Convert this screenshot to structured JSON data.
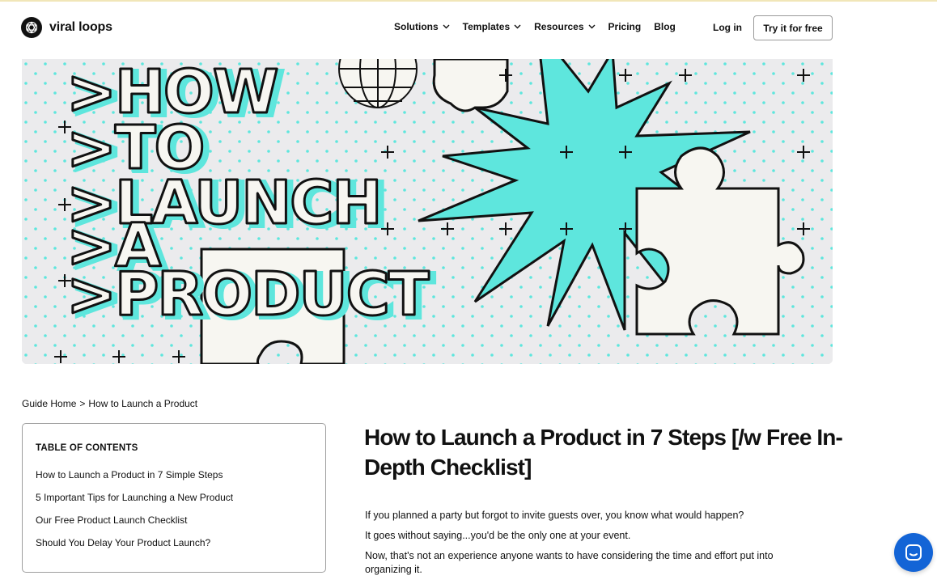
{
  "header": {
    "logo_text": "viral loops",
    "logo_icon": "viral-loops-logo-icon",
    "nav": [
      {
        "label": "Solutions",
        "has_dropdown": true
      },
      {
        "label": "Templates",
        "has_dropdown": true
      },
      {
        "label": "Resources",
        "has_dropdown": true
      },
      {
        "label": "Pricing",
        "has_dropdown": false
      },
      {
        "label": "Blog",
        "has_dropdown": false
      }
    ],
    "login_label": "Log in",
    "cta_label": "Try it for free"
  },
  "hero": {
    "lines": [
      ">HOW",
      ">TO",
      ">LAUNCH",
      ">A",
      ">PRODUCT"
    ],
    "colors": {
      "background": "#ebebed",
      "accent": "#5ee6dd",
      "ink": "#111111",
      "paper": "#f7f6f1"
    }
  },
  "breadcrumb": {
    "home": "Guide Home",
    "separator": ">",
    "current": "How to Launch a Product"
  },
  "toc": {
    "title": "TABLE OF CONTENTS",
    "items": [
      "How to Launch a Product in 7 Simple Steps",
      "5 Important Tips for Launching a New Product",
      "Our Free Product Launch Checklist",
      "Should You Delay Your Product Launch?"
    ]
  },
  "article": {
    "title": "How to Launch a Product in 7 Steps [/w Free In-Depth Checklist]",
    "paragraphs": [
      "If you planned a party but forgot to invite guests over, you know what would happen?",
      "It goes without saying...you'd be the only one at your event.",
      "Now, that's not an experience anyone wants to have considering the time and effort put into organizing it."
    ]
  },
  "chat_widget": {
    "icon": "chat-icon",
    "color": "#1364d6"
  }
}
